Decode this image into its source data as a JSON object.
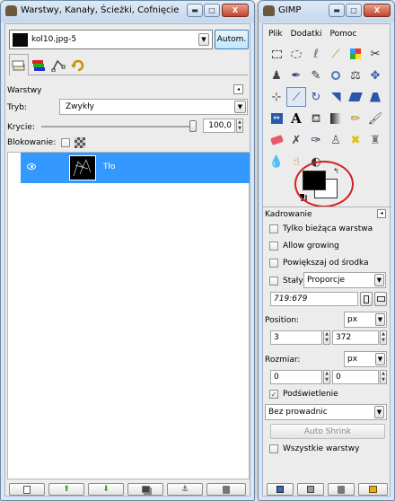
{
  "layers_window": {
    "title": "Warstwy, Kanały, Ścieżki, Cofnięcie",
    "controls": {
      "minimize": "▬",
      "maximize": "□",
      "close": "X"
    },
    "image_combo": {
      "value": "kol10.jpg-5",
      "auto_button": "Autom."
    },
    "panel_title": "Warstwy",
    "mode_label": "Tryb:",
    "mode_value": "Zwykły",
    "opacity_label": "Krycie:",
    "opacity_value": "100,0",
    "opacity_percent": 100,
    "lock_label": "Blokowanie:",
    "layers": [
      {
        "name": "Tło",
        "visible": true,
        "selected": true
      }
    ],
    "bottom_buttons": [
      "new-layer",
      "raise-layer",
      "lower-layer",
      "duplicate-layer",
      "anchor-layer",
      "delete-layer"
    ]
  },
  "gimp_window": {
    "title": "GIMP",
    "controls": {
      "minimize": "▬",
      "maximize": "□",
      "close": "X"
    },
    "menu": [
      "Plik",
      "Dodatki",
      "Pomoc"
    ],
    "tools": [
      "rect-select",
      "ellipse-select",
      "free-select",
      "fuzzy-select",
      "color-select",
      "scissors",
      "foreground-select",
      "paths",
      "color-picker",
      "zoom",
      "measure",
      "move",
      "align",
      "crop",
      "rotate",
      "scale",
      "shear",
      "perspective",
      "flip",
      "text",
      "bucket-fill",
      "blend",
      "pencil",
      "paintbrush",
      "eraser",
      "airbrush",
      "ink",
      "clone",
      "heal",
      "perspective-clone",
      "blur",
      "smudge",
      "dodge-burn"
    ],
    "colors": {
      "foreground": "#000000",
      "background": "#ffffff",
      "highlight_circle": "#d42020"
    },
    "options_title": "Kadrowanie",
    "only_current_layer": "Tylko bieżąca warstwa",
    "allow_growing": "Allow growing",
    "expand_from_center": "Powiększaj od środka",
    "fixed_label": "Stały:",
    "fixed_value": "Proporcje",
    "ratio_value": "719:679",
    "position_label": "Position:",
    "position_unit": "px",
    "position_x": "3",
    "position_y": "372",
    "size_label": "Rozmiar:",
    "size_unit": "px",
    "size_w": "0",
    "size_h": "0",
    "highlight_label": "Podświetlenie",
    "guides_value": "Bez prowadnic",
    "auto_shrink": "Auto Shrink",
    "all_layers": "Wszystkie warstwy",
    "bottom_buttons": [
      "save-options",
      "restore-options",
      "delete-options",
      "reset-options"
    ]
  }
}
